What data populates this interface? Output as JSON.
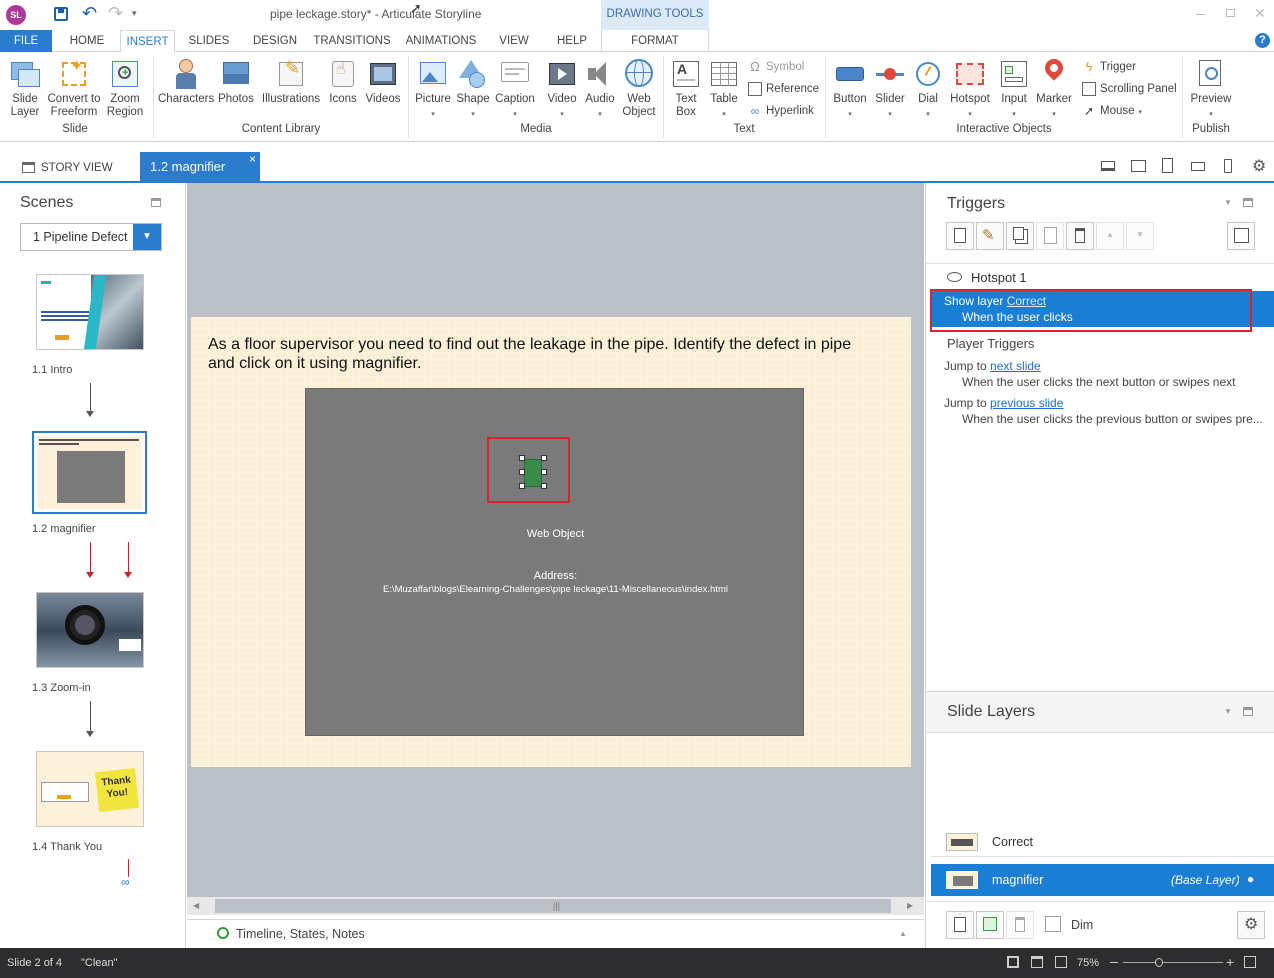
{
  "app": {
    "title": "pipe leckage.story* -  Articulate Storyline",
    "logo_text": "SL",
    "context_tab_group": "DRAWING TOOLS"
  },
  "menu": {
    "file": "FILE",
    "items": [
      "HOME",
      "INSERT",
      "SLIDES",
      "DESIGN",
      "TRANSITIONS",
      "ANIMATIONS",
      "VIEW",
      "HELP"
    ],
    "format": "FORMAT",
    "help_glyph": "?"
  },
  "ribbon": {
    "slide_group": {
      "label": "Slide",
      "buttons": [
        {
          "line1": "Slide",
          "line2": "Layer"
        },
        {
          "line1": "Convert to",
          "line2": "Freeform"
        },
        {
          "line1": "Zoom",
          "line2": "Region"
        }
      ]
    },
    "content_group": {
      "label": "Content Library",
      "buttons": [
        "Characters",
        "Photos",
        "Illustrations",
        "Icons",
        "Videos"
      ]
    },
    "media_group": {
      "label": "Media",
      "buttons": [
        "Picture",
        "Shape",
        "Caption",
        "Video",
        "Audio"
      ],
      "web_object": {
        "line1": "Web",
        "line2": "Object"
      }
    },
    "text_group": {
      "label": "Text",
      "text_box": {
        "line1": "Text",
        "line2": "Box"
      },
      "table": "Table",
      "small": [
        "Symbol",
        "Reference",
        "Hyperlink"
      ]
    },
    "interactive_group": {
      "label": "Interactive Objects",
      "buttons": [
        "Button",
        "Slider",
        "Dial",
        "Hotspot",
        "Input",
        "Marker"
      ],
      "small": [
        "Trigger",
        "Scrolling Panel",
        "Mouse"
      ]
    },
    "publish_group": {
      "label": "Publish",
      "preview": "Preview"
    }
  },
  "tabs": {
    "story_view": "STORY VIEW",
    "active": "1.2 magnifier",
    "close_glyph": "×"
  },
  "scenes": {
    "title": "Scenes",
    "dropdown_value": "1 Pipeline Defect",
    "slides": [
      {
        "label": "1.1 Intro"
      },
      {
        "label": "1.2 magnifier"
      },
      {
        "label": "1.3 Zoom-in"
      },
      {
        "label": "1.4 Thank You"
      }
    ],
    "thank_you_note": "Thank You!"
  },
  "slide": {
    "instruction": "As a floor supervisor you need to find out the leakage in the pipe. Identify the defect in pipe and click on it using magnifier.",
    "web_object_label": "Web Object",
    "address_label": "Address:",
    "address_path": "E:\\Muzaffar\\blogs\\Elearning-Challenges\\pipe leckage\\11-Miscellaneous\\index.html"
  },
  "timeline": {
    "label": "Timeline, States, Notes"
  },
  "triggers": {
    "title": "Triggers",
    "object_name": "Hotspot 1",
    "selected": {
      "prefix": "Show layer ",
      "link": "Correct",
      "condition": "When the user clicks"
    },
    "player_triggers_title": "Player Triggers",
    "player_triggers": [
      {
        "prefix": "Jump to ",
        "link": "next slide",
        "condition": "When the user clicks the next button or swipes next"
      },
      {
        "prefix": "Jump to ",
        "link": "previous slide",
        "condition": "When the user clicks the previous button or swipes pre..."
      }
    ]
  },
  "layers": {
    "title": "Slide Layers",
    "items": [
      {
        "name": "Correct",
        "tag": ""
      },
      {
        "name": "magnifier",
        "tag": "(Base Layer)"
      }
    ],
    "dim_label": "Dim"
  },
  "status": {
    "slide_pos": "Slide 2 of 4",
    "theme": "\"Clean\"",
    "zoom": "75%"
  },
  "colors": {
    "accent": "#2b7ccc",
    "selection": "#1a7fd4",
    "highlight_box": "#d9242b",
    "canvas_bg": "#bcc1c7",
    "slide_bg": "#fdf1da",
    "web_object": "#7a7a7a"
  }
}
